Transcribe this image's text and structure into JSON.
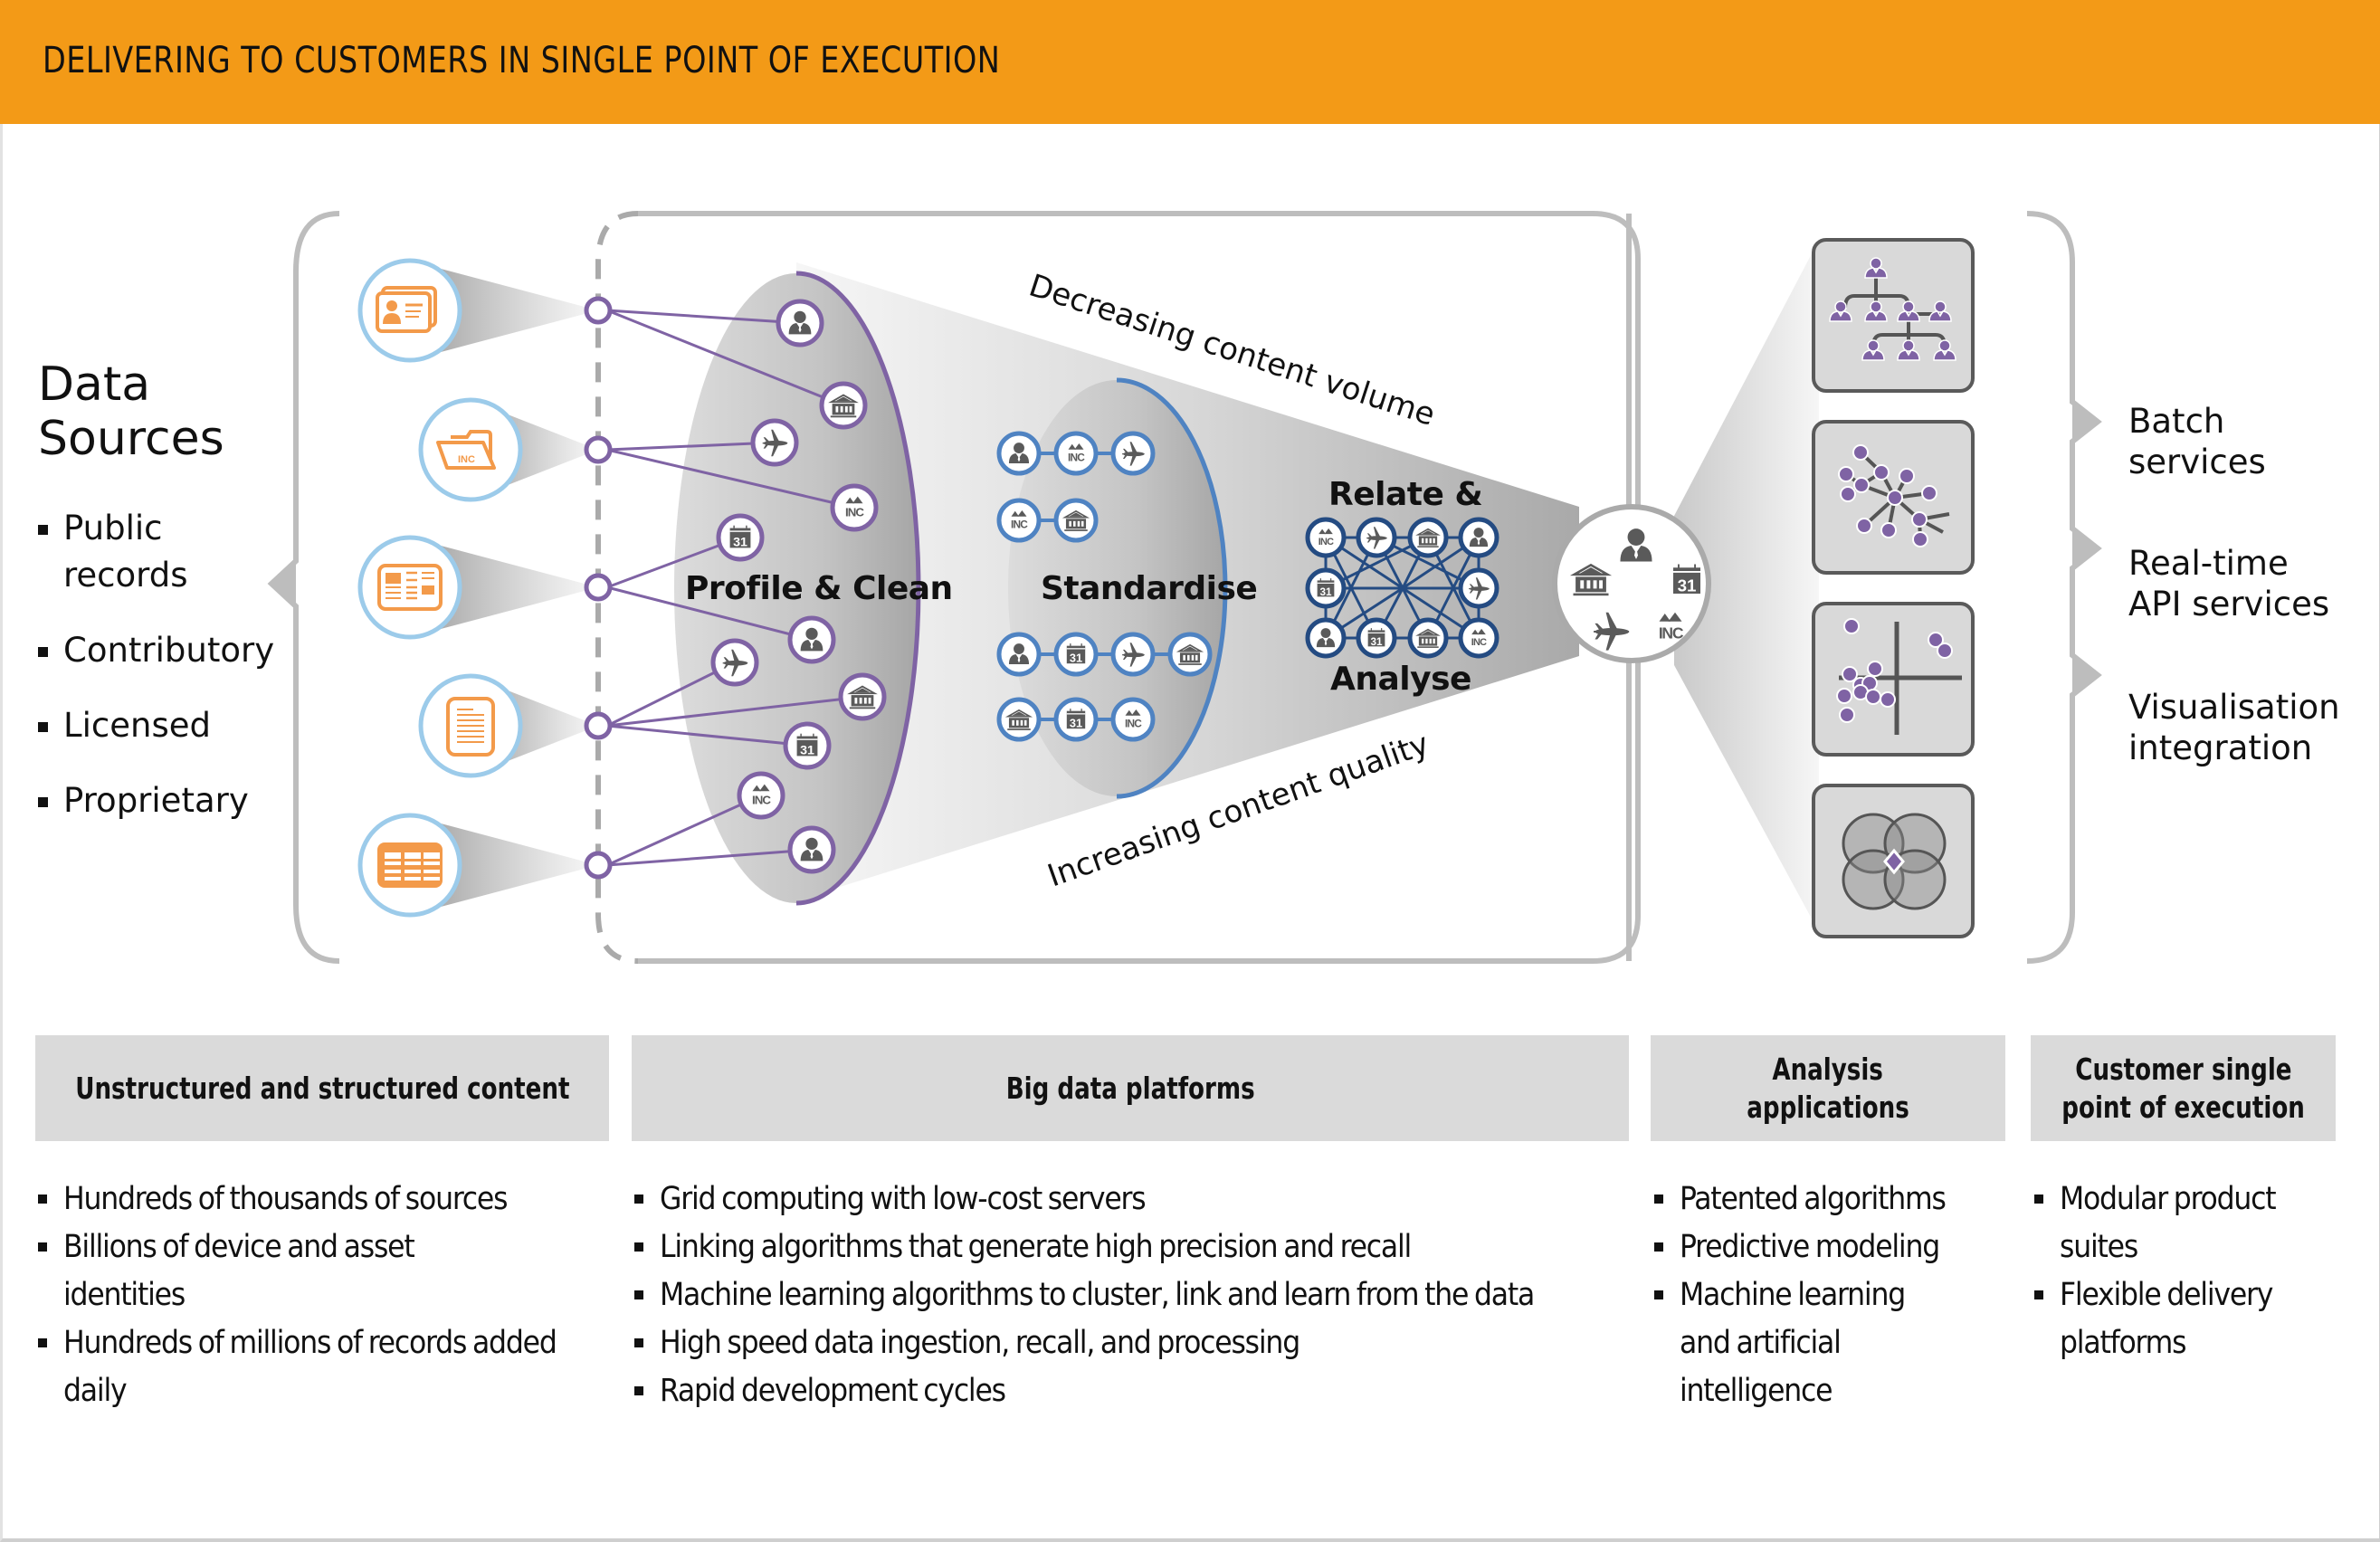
{
  "header": {
    "title": "DELIVERING TO CUSTOMERS IN SINGLE POINT OF EXECUTION"
  },
  "colors": {
    "header_bg": "#f39a17",
    "source_icon": "#f39a4a",
    "source_ring": "#9ccbea",
    "profile_ring": "#7f63a4",
    "standardise_ring": "#4f83c2",
    "relate_ring": "#244b82",
    "icon_gray": "#5a5a5a",
    "output_purple": "#7f63a4",
    "bracket_gray": "#bdbdbd",
    "bottom_header_bg": "#dadada"
  },
  "data_sources": {
    "title_line1": "Data",
    "title_line2": "Sources",
    "items": [
      {
        "line1": "Public",
        "line2": "records"
      },
      {
        "line1": "Contributory",
        "line2": ""
      },
      {
        "line1": "Licensed",
        "line2": ""
      },
      {
        "line1": "Proprietary",
        "line2": ""
      }
    ],
    "icons": [
      "id-card-icon",
      "folder-inc-icon",
      "newspaper-icon",
      "document-icon",
      "table-icon"
    ]
  },
  "stages": {
    "profile": "Profile & Clean",
    "standardise": "Standardise",
    "relate_line1": "Relate &",
    "relate_line2": "Analyse",
    "top_caption": "Decreasing content volume",
    "bottom_caption": "Increasing content quality"
  },
  "entity_icons": [
    "person-icon",
    "building-icon",
    "airplane-icon",
    "inc-icon",
    "calendar-icon"
  ],
  "outputs": {
    "boxes": [
      "org-chart-icon",
      "network-graph-icon",
      "scatter-plot-icon",
      "venn-diagram-icon"
    ],
    "labels": [
      {
        "line1": "Batch",
        "line2": "services"
      },
      {
        "line1": "Real-time",
        "line2": "API services"
      },
      {
        "line1": "Visualisation",
        "line2": "integration"
      }
    ]
  },
  "bottom": {
    "columns": [
      {
        "heading_line1": "Unstructured and structured content",
        "heading_line2": "",
        "bullets": [
          "Hundreds of thousands of sources",
          "Billions of device and asset identities",
          "Hundreds of millions of records added daily"
        ]
      },
      {
        "heading_line1": "Big data platforms",
        "heading_line2": "",
        "bullets": [
          "Grid computing with low-cost servers",
          "Linking algorithms that generate high precision and recall",
          "Machine learning algorithms to cluster, link and learn from the data",
          "High speed data ingestion, recall, and processing",
          "Rapid development cycles"
        ]
      },
      {
        "heading_line1": "Analysis",
        "heading_line2": "applications",
        "bullets": [
          "Patented algorithms",
          "Predictive modeling",
          "Machine learning and artificial intelligence"
        ]
      },
      {
        "heading_line1": "Customer single",
        "heading_line2": "point of execution",
        "bullets": [
          "Modular product suites",
          "Flexible delivery platforms"
        ]
      }
    ]
  }
}
